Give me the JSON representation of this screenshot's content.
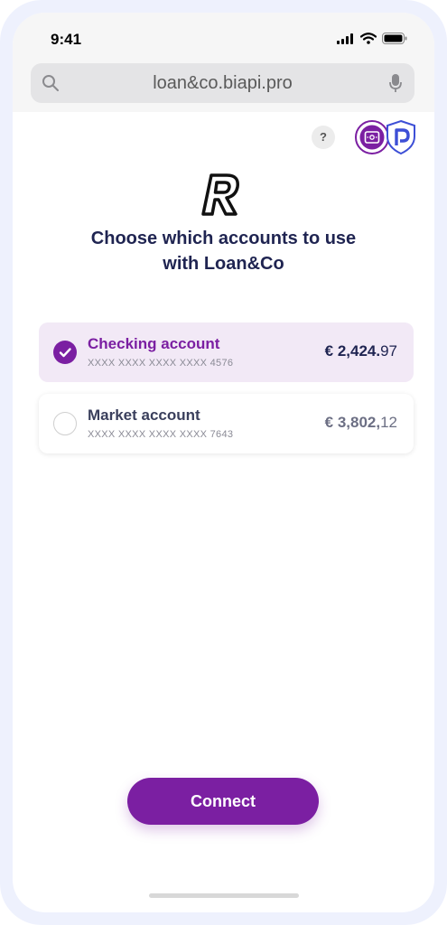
{
  "status_bar": {
    "time": "9:41"
  },
  "browser": {
    "url": "loan&co.biapi.pro"
  },
  "header": {
    "help_label": "?"
  },
  "title_lines": [
    "Choose which accounts to use",
    "with Loan&Co"
  ],
  "accounts": [
    {
      "name": "Checking account",
      "number": "XXXX XXXX XXXX XXXX 4576",
      "currency": "€",
      "amount_int": "2,424.",
      "amount_dec": "97",
      "selected": true
    },
    {
      "name": "Market account",
      "number": "XXXX XXXX XXXX XXXX 7643",
      "currency": "€",
      "amount_int": "3,802,",
      "amount_dec": "12",
      "selected": false
    }
  ],
  "connect_label": "Connect",
  "colors": {
    "accent": "#7b1fa2",
    "title": "#1f2451",
    "selected_bg": "#f2e9f6"
  }
}
